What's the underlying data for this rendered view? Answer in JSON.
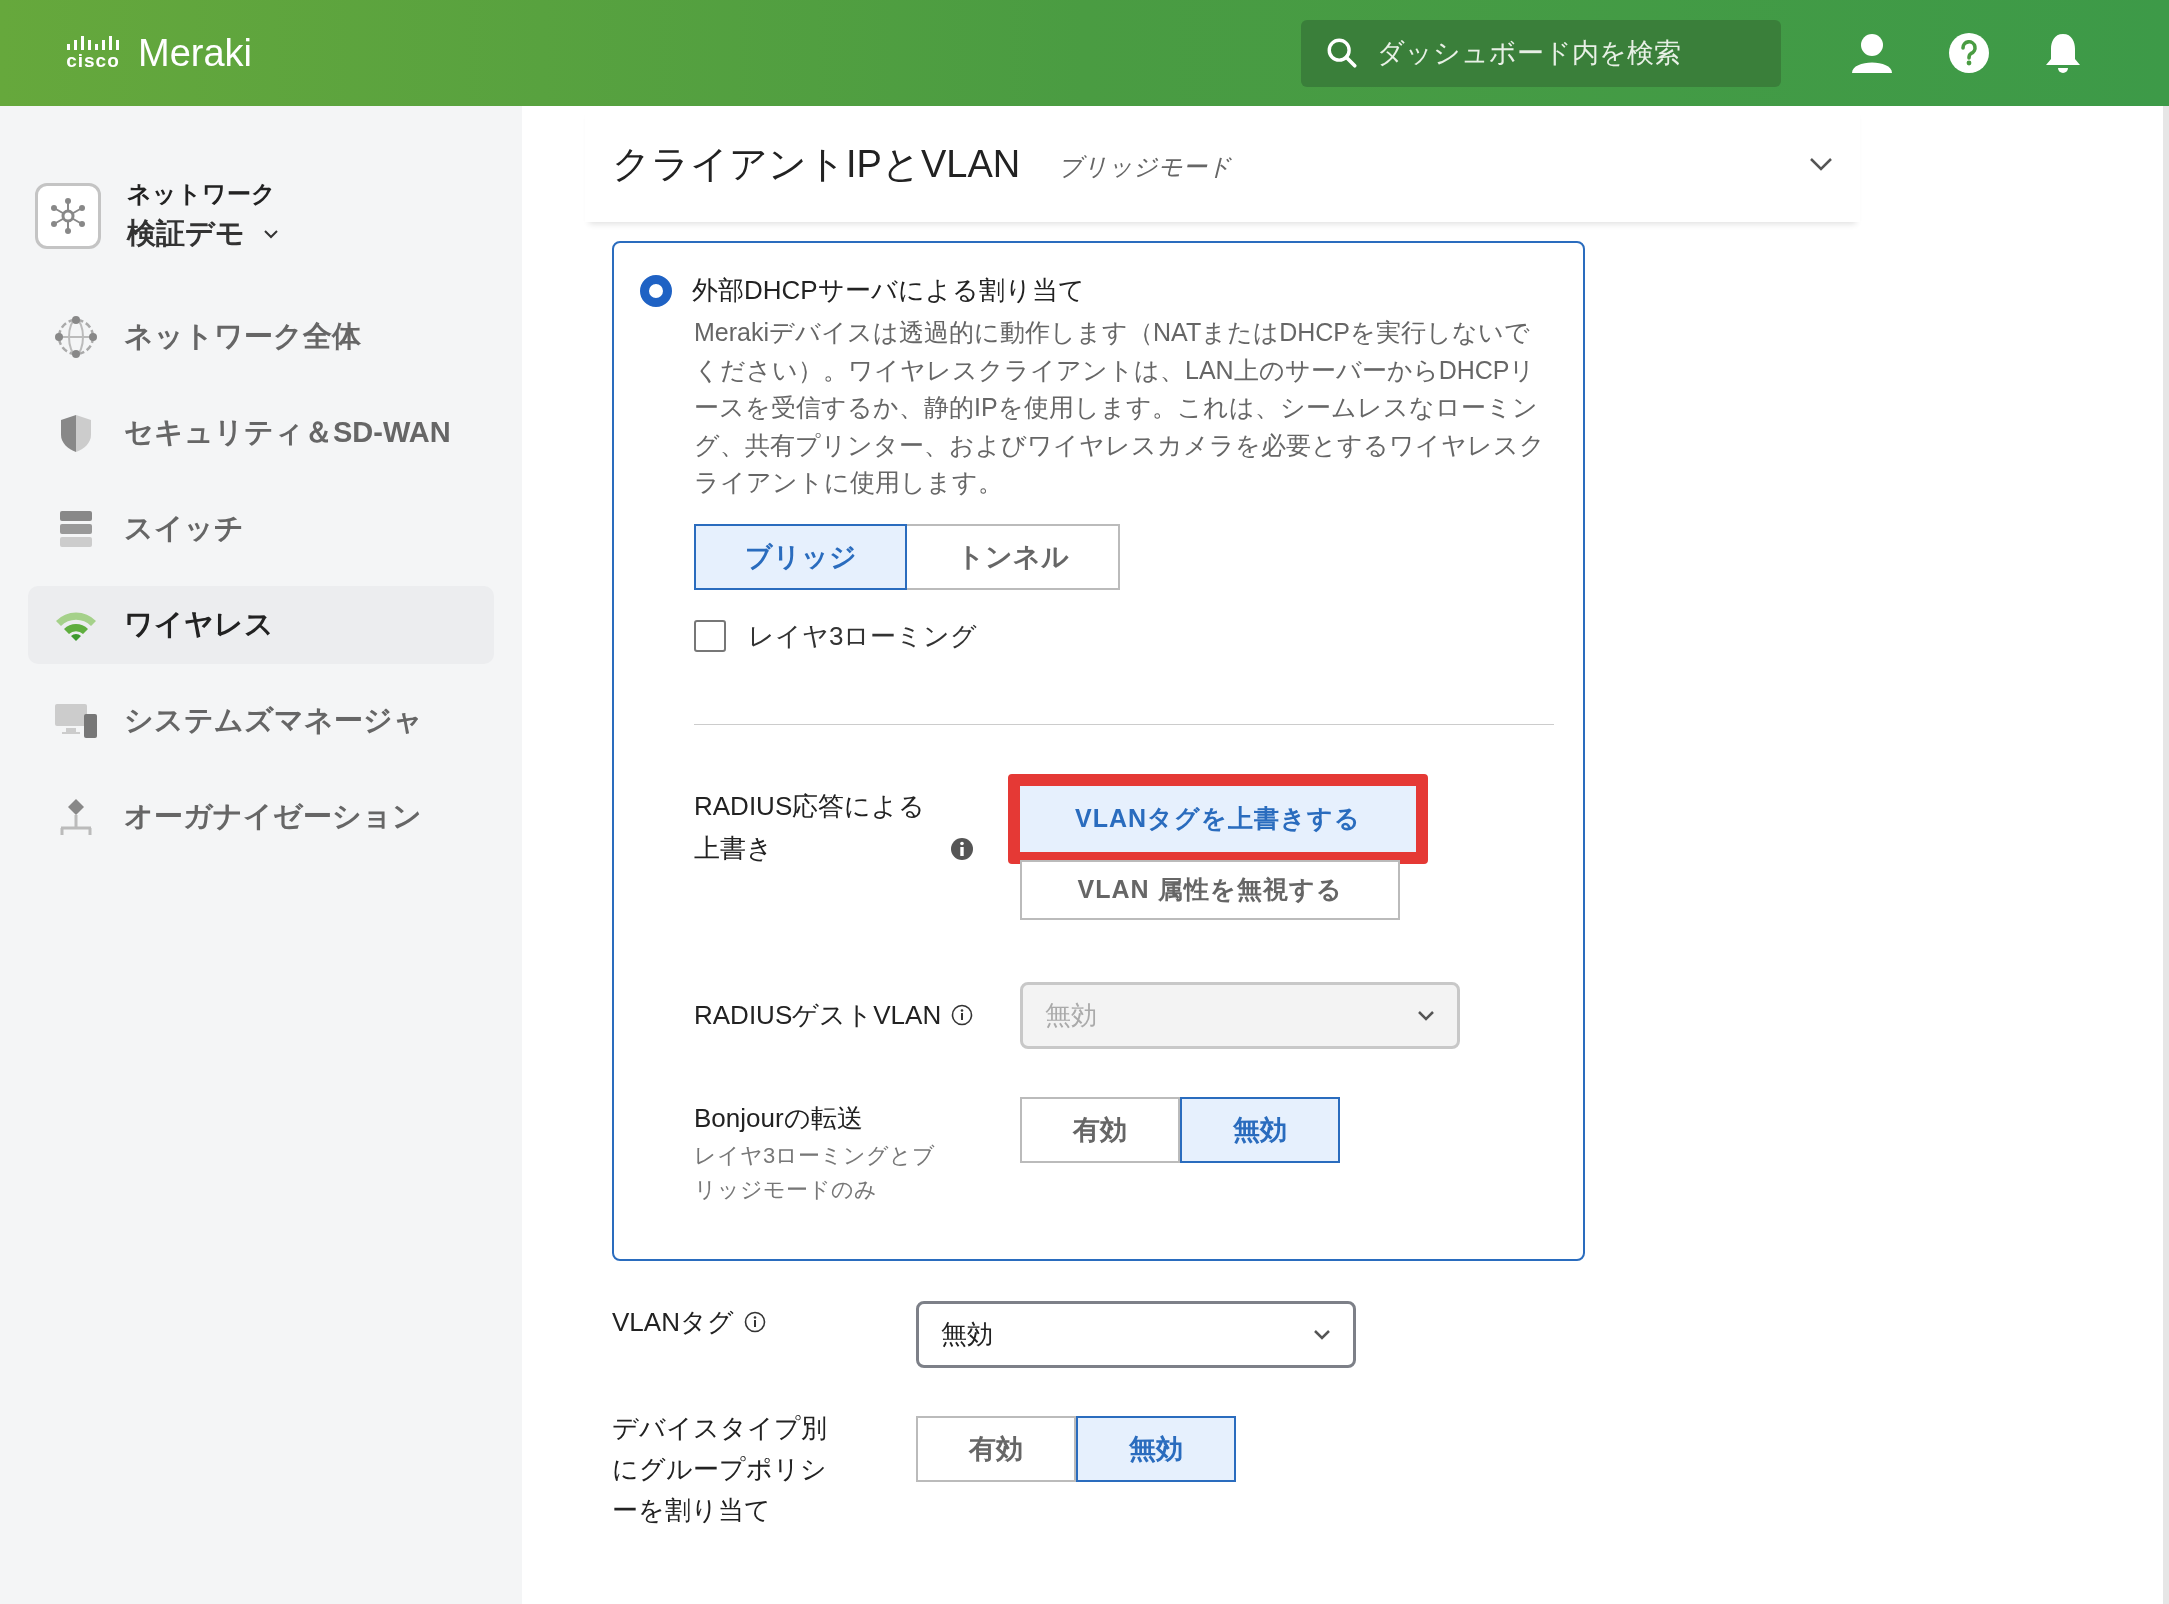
{
  "header": {
    "logo_mark": "cisco",
    "product": "Meraki",
    "search": {
      "placeholder": "ダッシュボード内を検索"
    }
  },
  "sidebar": {
    "network": {
      "label": "ネットワーク",
      "name": "検証デモ"
    },
    "items": [
      {
        "label": "ネットワーク全体",
        "kind": "globe",
        "selected": false
      },
      {
        "label": "セキュリティ＆SD-WAN",
        "kind": "shield",
        "selected": false
      },
      {
        "label": "スイッチ",
        "kind": "switch",
        "selected": false
      },
      {
        "label": "ワイヤレス",
        "kind": "wifi",
        "selected": true
      },
      {
        "label": "システムズマネージャ",
        "kind": "devices",
        "selected": false
      },
      {
        "label": "オーガナイゼーション",
        "kind": "org",
        "selected": false
      }
    ]
  },
  "section": {
    "title": "クライアントIPとVLAN",
    "subtitle": "ブリッジモード"
  },
  "card": {
    "option": {
      "label": "外部DHCPサーバによる割り当て",
      "selected": true,
      "description": "Merakiデバイスは透過的に動作します（NATまたはDHCPを実行しないでください）。ワイヤレスクライアントは、LAN上のサーバーからDHCPリースを受信するか、静的IPを使用します。これは、シームレスなローミング、共有プリンター、およびワイヤレスカメラを必要とするワイヤレスクライアントに使用します。"
    },
    "mode_tabs": [
      {
        "label": "ブリッジ",
        "selected": true
      },
      {
        "label": "トンネル",
        "selected": false
      }
    ],
    "layer3_roaming": {
      "label": "レイヤ3ローミング",
      "checked": false
    },
    "radius_override": {
      "label": "RADIUS応答による上書き",
      "options": [
        {
          "label": "VLANタグを上書きする",
          "selected": true,
          "highlighted": true
        },
        {
          "label": "VLAN 属性を無視する",
          "selected": false,
          "highlighted": false
        }
      ]
    },
    "radius_guest_vlan": {
      "label": "RADIUSゲストVLAN",
      "value": "無効",
      "disabled": true
    },
    "bonjour": {
      "label": "Bonjourの転送",
      "note": "レイヤ3ローミングとブリッジモードのみ",
      "options": [
        {
          "label": "有効",
          "selected": false
        },
        {
          "label": "無効",
          "selected": true
        }
      ]
    }
  },
  "vlan_tag": {
    "label": "VLANタグ",
    "value": "無効",
    "disabled": false
  },
  "device_policy": {
    "label": "デバイスタイプ別にグループポリシーを割り当て",
    "options": [
      {
        "label": "有効",
        "selected": false
      },
      {
        "label": "無効",
        "selected": true
      }
    ]
  }
}
